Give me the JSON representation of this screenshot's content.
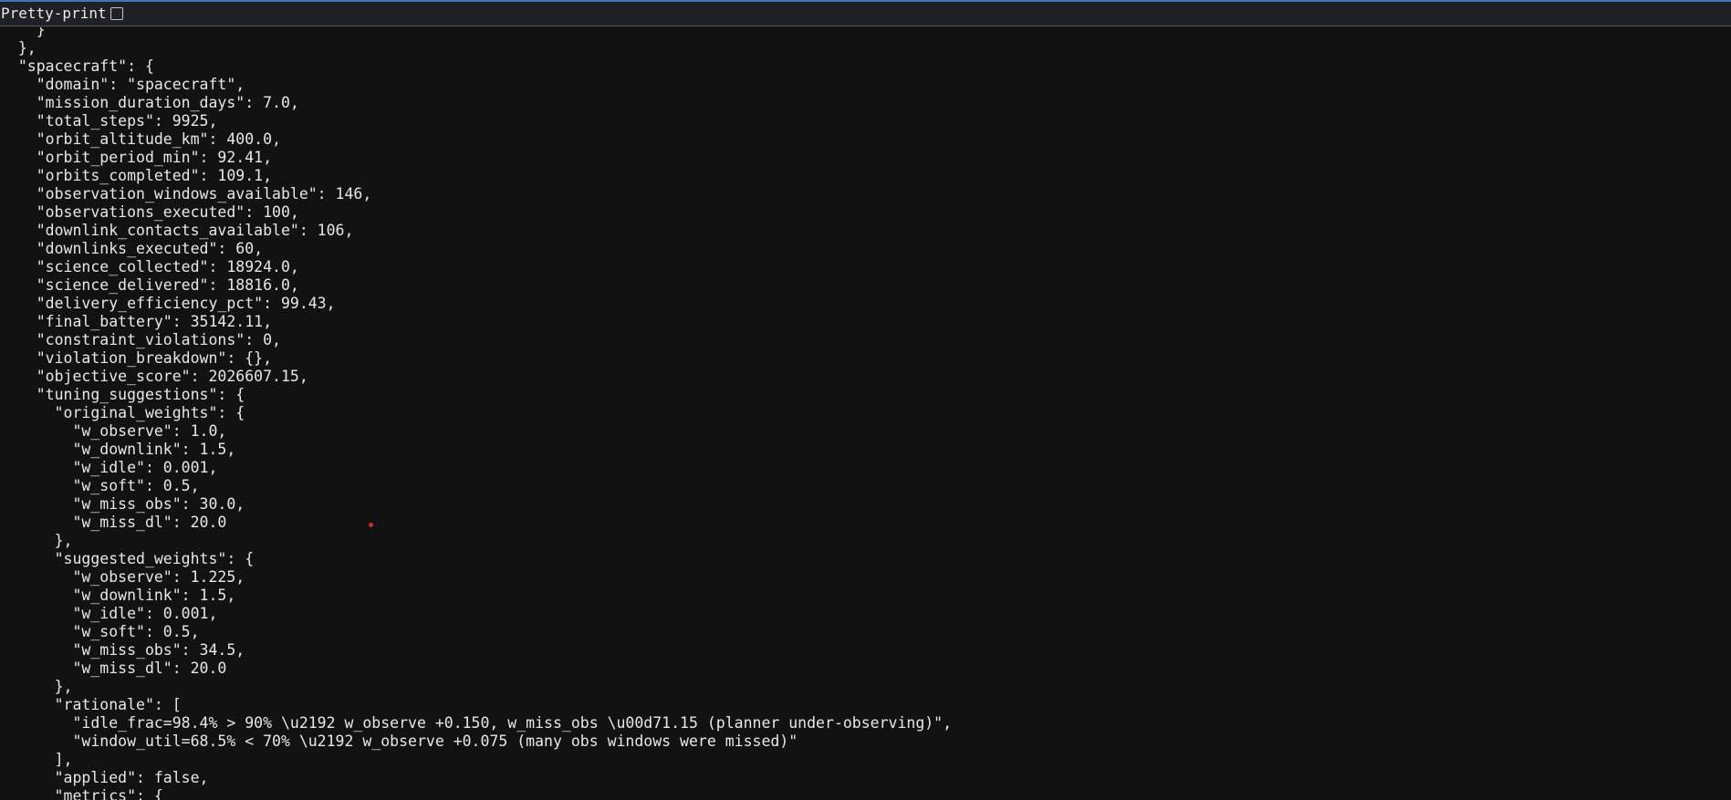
{
  "toolbar": {
    "pretty_print_label": "Pretty-print",
    "pretty_print_checked": false
  },
  "json_lines": [
    "    }",
    "  },",
    "  \"spacecraft\": {",
    "    \"domain\": \"spacecraft\",",
    "    \"mission_duration_days\": 7.0,",
    "    \"total_steps\": 9925,",
    "    \"orbit_altitude_km\": 400.0,",
    "    \"orbit_period_min\": 92.41,",
    "    \"orbits_completed\": 109.1,",
    "    \"observation_windows_available\": 146,",
    "    \"observations_executed\": 100,",
    "    \"downlink_contacts_available\": 106,",
    "    \"downlinks_executed\": 60,",
    "    \"science_collected\": 18924.0,",
    "    \"science_delivered\": 18816.0,",
    "    \"delivery_efficiency_pct\": 99.43,",
    "    \"final_battery\": 35142.11,",
    "    \"constraint_violations\": 0,",
    "    \"violation_breakdown\": {},",
    "    \"objective_score\": 2026607.15,",
    "    \"tuning_suggestions\": {",
    "      \"original_weights\": {",
    "        \"w_observe\": 1.0,",
    "        \"w_downlink\": 1.5,",
    "        \"w_idle\": 0.001,",
    "        \"w_soft\": 0.5,",
    "        \"w_miss_obs\": 30.0,",
    "        \"w_miss_dl\": 20.0",
    "      },",
    "      \"suggested_weights\": {",
    "        \"w_observe\": 1.225,",
    "        \"w_downlink\": 1.5,",
    "        \"w_idle\": 0.001,",
    "        \"w_soft\": 0.5,",
    "        \"w_miss_obs\": 34.5,",
    "        \"w_miss_dl\": 20.0",
    "      },",
    "      \"rationale\": [",
    "        \"idle_frac=98.4% > 90% \\u2192 w_observe +0.150, w_miss_obs \\u00d71.15 (planner under-observing)\",",
    "        \"window_util=68.5% < 70% \\u2192 w_observe +0.075 (many obs windows were missed)\"",
    "      ],",
    "      \"applied\": false,",
    "      \"metrics\": {"
  ],
  "colors": {
    "background": "#121212",
    "text": "#e8e8e8",
    "toolbar_bg": "#202124",
    "accent": "#3f73b8",
    "pointer_dot": "#d22b2b"
  }
}
